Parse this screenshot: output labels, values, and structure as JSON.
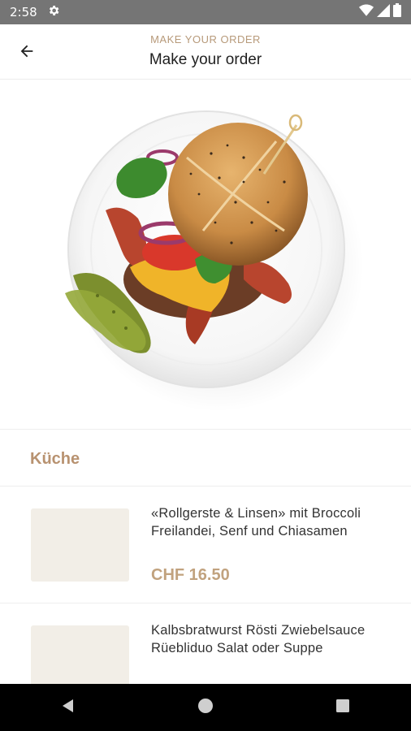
{
  "status_bar": {
    "time": "2:58",
    "icons": [
      "settings-gear-icon",
      "wifi-icon",
      "signal-icon",
      "battery-icon"
    ]
  },
  "header": {
    "kicker": "MAKE YOUR ORDER",
    "title": "Make your order",
    "back_icon": "arrow-left-icon"
  },
  "hero": {
    "image": "burger-on-plate-with-pickles-photo"
  },
  "section": {
    "title": "Küche"
  },
  "menu_items": [
    {
      "name": "«Rollgerste & Linsen» mit Broccoli Freilandei, Senf und Chiasamen",
      "price": "CHF 16.50"
    },
    {
      "name": "Kalbsbratwurst Rösti Zwiebelsauce Rüebliduo Salat oder Suppe"
    }
  ],
  "nav_bar": {
    "buttons": [
      "back-triangle-icon",
      "home-circle-icon",
      "recents-square-icon"
    ]
  },
  "colors": {
    "accent": "#b89270",
    "status_bar": "#757575",
    "thumb_placeholder": "#f2eee7"
  }
}
